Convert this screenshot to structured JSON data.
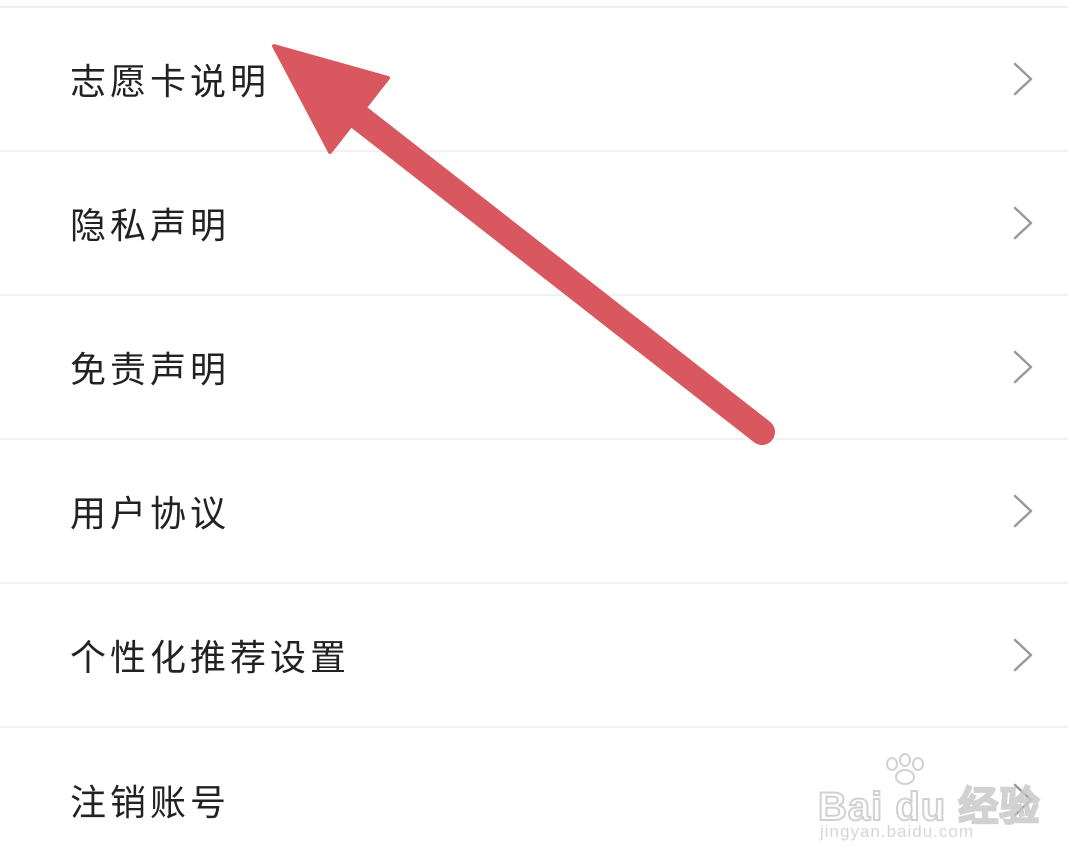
{
  "menu": {
    "items": [
      {
        "label": "志愿卡说明",
        "icon": "chevron-right-icon"
      },
      {
        "label": "隐私声明",
        "icon": "chevron-right-icon"
      },
      {
        "label": "免责声明",
        "icon": "chevron-right-icon"
      },
      {
        "label": "用户协议",
        "icon": "chevron-right-icon"
      },
      {
        "label": "个性化推荐设置",
        "icon": "chevron-right-icon"
      },
      {
        "label": "注销账号",
        "icon": "chevron-right-icon"
      }
    ]
  },
  "annotation": {
    "type": "pointer-arrow",
    "color": "#d9575f",
    "points_to": "志愿卡说明"
  },
  "watermark": {
    "brand": "Bai du 经验",
    "url": "jingyan.baidu.com"
  },
  "colors": {
    "background": "#ffffff",
    "divider": "#f1f1f1",
    "text": "#222222",
    "chevron": "#9a9a9a",
    "arrow": "#d9575f"
  }
}
